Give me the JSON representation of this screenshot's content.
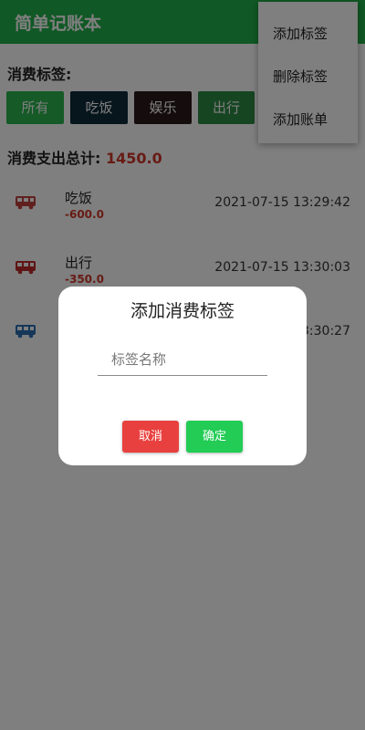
{
  "app": {
    "title": "简单记账本"
  },
  "tags_section": {
    "label": "消费标签:",
    "tags": [
      "所有",
      "吃饭",
      "娱乐",
      "出行"
    ]
  },
  "summary": {
    "label": "消费支出总计:",
    "value": "1450.0"
  },
  "records": [
    {
      "category": "吃饭",
      "amount": "-600.0",
      "time": "2021-07-15 13:29:42",
      "icon": "bus-icon",
      "icon_color": "#c0403a"
    },
    {
      "category": "出行",
      "amount": "-350.0",
      "time": "2021-07-15 13:30:03",
      "icon": "bus-icon",
      "icon_color": "#c02a2a"
    },
    {
      "category": "",
      "amount": "",
      "time": "3:30:27",
      "icon": "bus-icon",
      "icon_color": "#2a6fb0"
    }
  ],
  "overflow_menu": {
    "items": [
      "添加标签",
      "删除标签",
      "添加账单"
    ]
  },
  "dialog": {
    "title": "添加消费标签",
    "input_value": "",
    "input_placeholder": "标签名称",
    "cancel_label": "取消",
    "confirm_label": "确定"
  },
  "colors": {
    "primary": "#21b14a",
    "expense": "#d0362a",
    "cancel": "#e8403e",
    "confirm": "#22cc55"
  }
}
